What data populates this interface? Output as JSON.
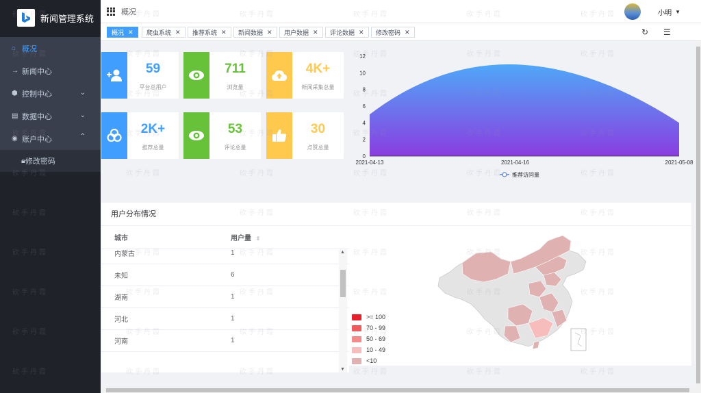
{
  "app": {
    "title": "新闻管理系统"
  },
  "sidebar": {
    "items": [
      {
        "label": "概况",
        "icon": "home-icon"
      },
      {
        "label": "新闻中心",
        "icon": "arrow-right-icon"
      },
      {
        "label": "控制中心",
        "icon": "cube-icon"
      },
      {
        "label": "数据中心",
        "icon": "database-icon"
      },
      {
        "label": "账户中心",
        "icon": "user-circle-icon"
      }
    ],
    "sub_item": {
      "label": "修改密码",
      "icon": "lock-icon"
    }
  },
  "header": {
    "breadcrumb": "概况",
    "user_name": "小明"
  },
  "tags": [
    {
      "label": "概况"
    },
    {
      "label": "爬虫系统"
    },
    {
      "label": "推荐系统"
    },
    {
      "label": "新闻数据"
    },
    {
      "label": "用户数据"
    },
    {
      "label": "评论数据"
    },
    {
      "label": "修改密码"
    }
  ],
  "stats": [
    {
      "value": "59",
      "label": "平台总用户",
      "color": "#409eff",
      "icon": "user-plus-icon"
    },
    {
      "value": "711",
      "label": "浏览量",
      "color": "#67c23a",
      "icon": "eye-icon"
    },
    {
      "value": "4K+",
      "label": "新闻采集总量",
      "color": "#ffc94d",
      "icon": "cloud-upload-icon"
    },
    {
      "value": "2K+",
      "label": "推荐总量",
      "color": "#409eff",
      "icon": "cluster-icon"
    },
    {
      "value": "53",
      "label": "评论总量",
      "color": "#67c23a",
      "icon": "eye-icon"
    },
    {
      "value": "30",
      "label": "点赞总量",
      "color": "#ffc94d",
      "icon": "thumbs-up-icon"
    }
  ],
  "chart_data": {
    "type": "area",
    "x": [
      "2021-04-13",
      "2021-04-16",
      "2021-05-08"
    ],
    "series": [
      {
        "name": "推荐访问量",
        "values": [
          5,
          11,
          4
        ]
      }
    ],
    "ylim": [
      0,
      12
    ],
    "yticks": [
      "0",
      "2",
      "4",
      "6",
      "8",
      "10",
      "12"
    ],
    "legend_position": "bottom",
    "grid": false,
    "colors": {
      "top": "#4fa8f8",
      "bottom": "#8a3de0"
    }
  },
  "distribution": {
    "title": "用户分布情况",
    "columns": [
      "城市",
      "用户量"
    ],
    "rows": [
      {
        "city": "内蒙古",
        "count": "1"
      },
      {
        "city": "未知",
        "count": "6"
      },
      {
        "city": "湖南",
        "count": "1"
      },
      {
        "city": "河北",
        "count": "1"
      },
      {
        "city": "河南",
        "count": "1"
      }
    ],
    "legend": [
      {
        "label": ">= 100",
        "color": "#e8202a"
      },
      {
        "label": "70 - 99",
        "color": "#f05a5a"
      },
      {
        "label": "50 - 69",
        "color": "#f38b8b"
      },
      {
        "label": "10 - 49",
        "color": "#f7bcbc"
      },
      {
        "label": "<10",
        "color": "#dfb1b1"
      }
    ]
  },
  "watermark": "砍手丹霞"
}
